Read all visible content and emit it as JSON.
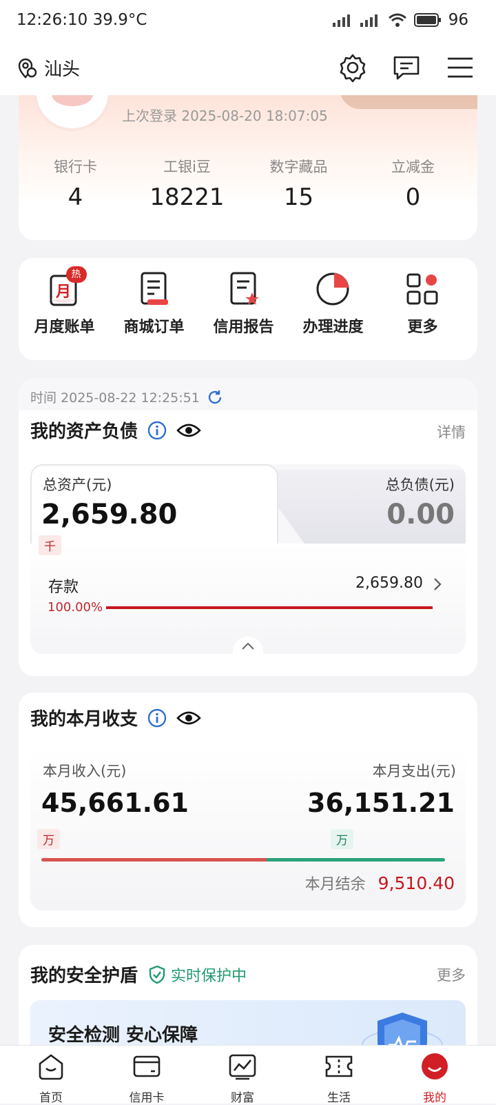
{
  "status_bar": {
    "time": "12:26:10",
    "temp": "39.9°C",
    "battery": "96"
  },
  "header": {
    "location": "汕头"
  },
  "profile": {
    "last_login": "上次登录 2025-08-20 18:07:05",
    "stats": [
      {
        "label": "银行卡",
        "value": "4"
      },
      {
        "label": "工银i豆",
        "value": "18221"
      },
      {
        "label": "数字藏品",
        "value": "15"
      },
      {
        "label": "立减金",
        "value": "0"
      }
    ]
  },
  "quick_menu": {
    "hot_badge": "热",
    "items": [
      {
        "label": "月度账单",
        "icon": "monthly-bill-icon"
      },
      {
        "label": "商城订单",
        "icon": "mall-order-icon"
      },
      {
        "label": "信用报告",
        "icon": "credit-report-icon"
      },
      {
        "label": "办理进度",
        "icon": "progress-pie-icon"
      },
      {
        "label": "更多",
        "icon": "more-grid-icon"
      }
    ],
    "month_glyph": "月"
  },
  "assets": {
    "time_label": "时间 2025-08-22 12:25:51",
    "title": "我的资产负债",
    "detail_link": "详情",
    "total_assets_label": "总资产(元)",
    "total_assets_value": "2,659.80",
    "total_assets_unit": "千",
    "total_debt_label": "总负债(元)",
    "total_debt_value": "0.00",
    "deposit_label": "存款",
    "deposit_value": "2,659.80",
    "deposit_percent": "100.00%",
    "deposit_fraction": 1.0
  },
  "monthly": {
    "title": "我的本月收支",
    "income_label": "本月收入(元)",
    "income_value": "45,661.61",
    "income_unit": "万",
    "expense_label": "本月支出(元)",
    "expense_value": "36,151.21",
    "expense_unit": "万",
    "balance_label": "本月结余",
    "balance_value": "9,510.40",
    "income_fraction": 0.558,
    "colors": {
      "income": "#d9534f",
      "expense": "#2aa27a",
      "balance": "#c8161d"
    }
  },
  "security": {
    "title": "我的安全护盾",
    "status": "实时保护中",
    "more_link": "更多",
    "banner_text": "安全检测 安心保障"
  },
  "bottom_nav": [
    {
      "label": "首页",
      "icon": "home-icon"
    },
    {
      "label": "信用卡",
      "icon": "credit-card-icon"
    },
    {
      "label": "财富",
      "icon": "wealth-chart-icon"
    },
    {
      "label": "生活",
      "icon": "ticket-icon"
    },
    {
      "label": "我的",
      "icon": "profile-smile-icon"
    }
  ],
  "brand_color": "#d01f25"
}
